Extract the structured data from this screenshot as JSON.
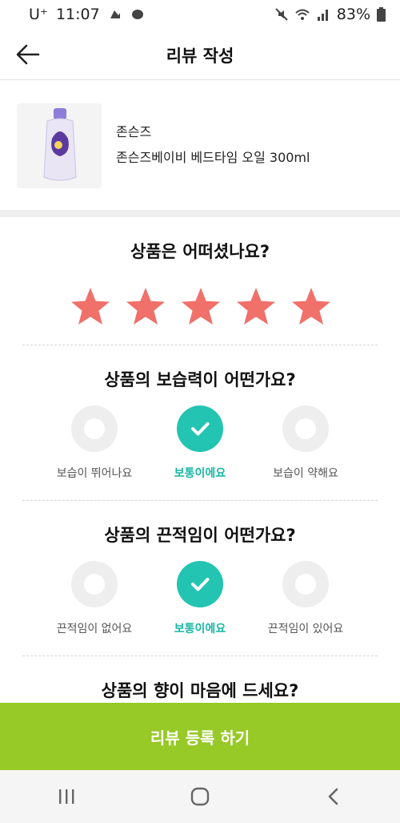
{
  "status_bar": {
    "carrier": "U⁺",
    "time": "11:07",
    "battery": "83%"
  },
  "header": {
    "title": "리뷰 작성"
  },
  "product": {
    "brand": "존슨즈",
    "name": "존슨즈베이비 베드타임 오일 300ml"
  },
  "rating_question": {
    "title": "상품은 어떠셨나요?",
    "stars": 5,
    "selected": 5,
    "star_color": "#f0706a"
  },
  "questions": [
    {
      "title": "상품의 보습력이 어떤가요?",
      "options": [
        "보습이 뛰어나요",
        "보통이에요",
        "보습이 약해요"
      ],
      "selected_index": 1
    },
    {
      "title": "상품의 끈적임이 어떤가요?",
      "options": [
        "끈적임이 없어요",
        "보통이에요",
        "끈적임이 있어요"
      ],
      "selected_index": 1
    },
    {
      "title": "상품의 향이 마음에 드세요?"
    }
  ],
  "cta": {
    "label": "리뷰 등록 하기",
    "color": "#97c927"
  },
  "colors": {
    "accent_teal": "#23c4b1",
    "cta_green": "#97c927"
  }
}
